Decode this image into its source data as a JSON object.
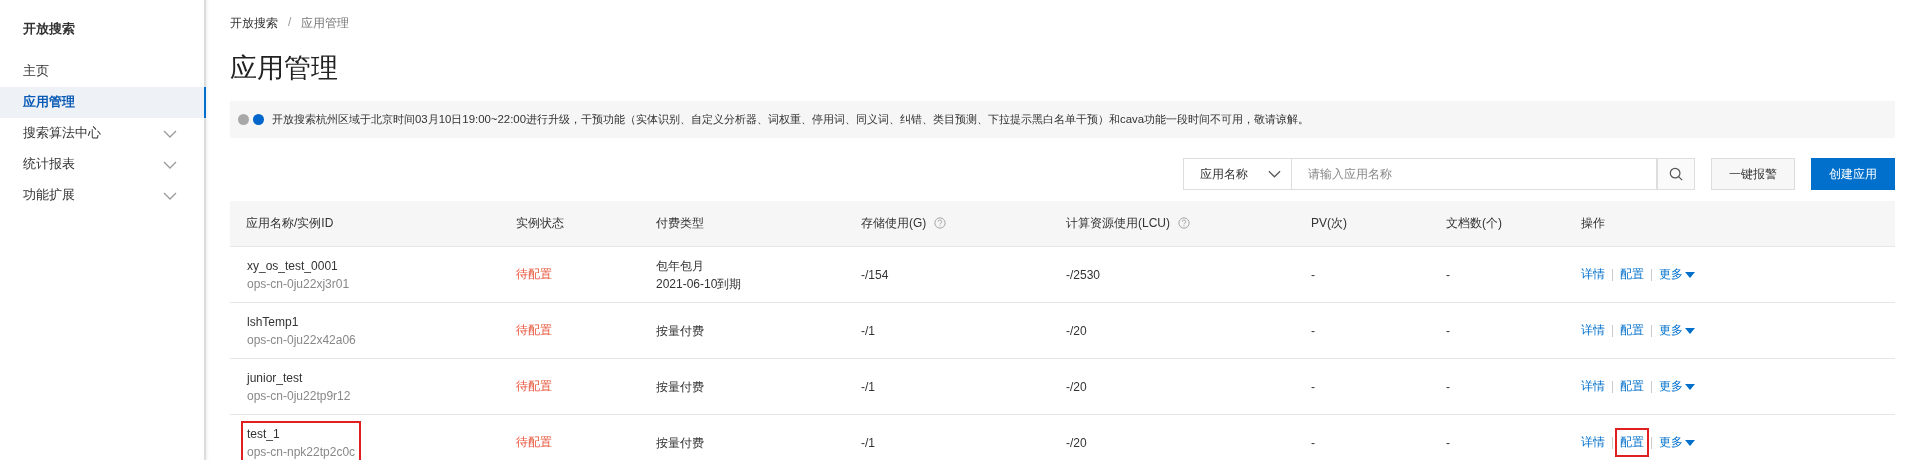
{
  "sidebar": {
    "title": "开放搜索",
    "items": [
      {
        "label": "主页",
        "selected": false,
        "expandable": false
      },
      {
        "label": "应用管理",
        "selected": true,
        "expandable": false
      },
      {
        "label": "搜索算法中心",
        "selected": false,
        "expandable": true
      },
      {
        "label": "统计报表",
        "selected": false,
        "expandable": true
      },
      {
        "label": "功能扩展",
        "selected": false,
        "expandable": true
      }
    ]
  },
  "breadcrumb": {
    "separator": "/",
    "items": [
      "开放搜索",
      "应用管理"
    ]
  },
  "page_title": "应用管理",
  "notice": {
    "indicators": [
      {
        "selected": false
      },
      {
        "selected": true
      }
    ],
    "text": "开放搜索杭州区域于北京时间03月10日19:00~22:00进行升级，干预功能（实体识别、自定义分析器、词权重、停用词、同义词、纠错、类目预测、下拉提示黑白名单干预）和cava功能一段时间不可用，敬请谅解。"
  },
  "toolbar": {
    "search_by": "应用名称",
    "placeholder": "请输入应用名称",
    "buttons": [
      {
        "label": "一键报警",
        "kind": "default"
      },
      {
        "label": "创建应用",
        "kind": "primary"
      }
    ]
  },
  "table": {
    "columns": [
      {
        "label": "应用名称/实例ID",
        "help": false
      },
      {
        "label": "实例状态",
        "help": false
      },
      {
        "label": "付费类型",
        "help": false
      },
      {
        "label": "存储使用(G)",
        "help": true
      },
      {
        "label": "计算资源使用(LCU)",
        "help": true
      },
      {
        "label": "PV(次)",
        "help": false
      },
      {
        "label": "文档数(个)",
        "help": false
      },
      {
        "label": "操作",
        "help": false
      }
    ],
    "rows": [
      {
        "name": "xy_os_test_0001",
        "id": "ops-cn-0ju22xj3r01",
        "highlighted": false,
        "status": "待配置",
        "billing": [
          "包年包月",
          "2021-06-10到期"
        ],
        "storage": "-/154",
        "compute": "-/2530",
        "pv": "-",
        "docs": "-",
        "actions": [
          {
            "label": "详情",
            "kind": "link",
            "highlighted": false
          },
          {
            "label": "配置",
            "kind": "link",
            "highlighted": false
          },
          {
            "label": "更多",
            "kind": "dropdown",
            "highlighted": false
          }
        ]
      },
      {
        "name": "lshTemp1",
        "id": "ops-cn-0ju22x42a06",
        "highlighted": false,
        "status": "待配置",
        "billing": [
          "按量付费"
        ],
        "storage": "-/1",
        "compute": "-/20",
        "pv": "-",
        "docs": "-",
        "actions": [
          {
            "label": "详情",
            "kind": "link",
            "highlighted": false
          },
          {
            "label": "配置",
            "kind": "link",
            "highlighted": false
          },
          {
            "label": "更多",
            "kind": "dropdown",
            "highlighted": false
          }
        ]
      },
      {
        "name": "junior_test",
        "id": "ops-cn-0ju22tp9r12",
        "highlighted": false,
        "status": "待配置",
        "billing": [
          "按量付费"
        ],
        "storage": "-/1",
        "compute": "-/20",
        "pv": "-",
        "docs": "-",
        "actions": [
          {
            "label": "详情",
            "kind": "link",
            "highlighted": false
          },
          {
            "label": "配置",
            "kind": "link",
            "highlighted": false
          },
          {
            "label": "更多",
            "kind": "dropdown",
            "highlighted": false
          }
        ]
      },
      {
        "name": "test_1",
        "id": "ops-cn-npk22tp2c0c",
        "highlighted": true,
        "status": "待配置",
        "billing": [
          "按量付费"
        ],
        "storage": "-/1",
        "compute": "-/20",
        "pv": "-",
        "docs": "-",
        "actions": [
          {
            "label": "详情",
            "kind": "link",
            "highlighted": false
          },
          {
            "label": "配置",
            "kind": "link",
            "highlighted": true
          },
          {
            "label": "更多",
            "kind": "dropdown",
            "highlighted": false
          }
        ]
      }
    ]
  }
}
